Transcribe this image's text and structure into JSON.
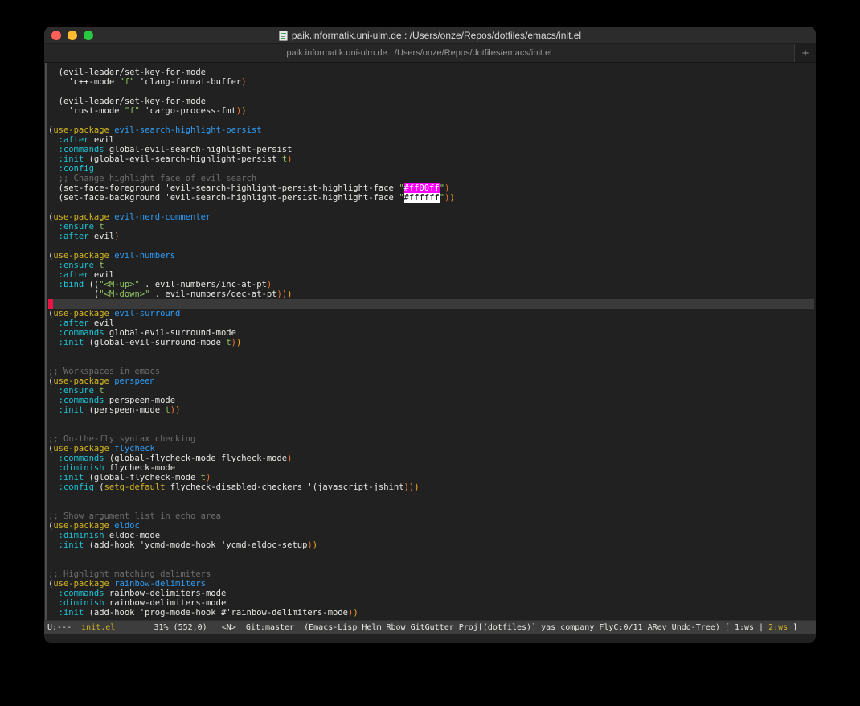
{
  "window": {
    "title": "paik.informatik.uni-ulm.de :  /Users/onze/Repos/dotfiles/emacs/init.el",
    "tab_title": "paik.informatik.uni-ulm.de :  /Users/onze/Repos/dotfiles/emacs/init.el",
    "new_tab_label": "+",
    "file_icon": "document-icon"
  },
  "colors": {
    "accent_yellow": "#d4b520",
    "package_blue": "#2e9cf5",
    "keyword_cyan": "#1fc3d4",
    "string_green": "#93c763",
    "comment_gray": "#6d6d6d",
    "paren_orange": "#ef7733",
    "paren_amber": "#fcae1e",
    "cursor_red": "#ee1346",
    "hexswatch_magenta": "#ff00ff",
    "hexswatch_white": "#ffffff",
    "editor_bg": "#212121",
    "hl_line_bg": "#3a3a3a",
    "modeline_bg": "#3d3d3d",
    "traffic_red": "#ff5f57",
    "traffic_yellow": "#febc2e",
    "traffic_green": "#28c840"
  },
  "editor": {
    "cursor_line_index": 24,
    "lines": [
      [
        [
          "d",
          "  (evil-leader/set-key-for-mode"
        ]
      ],
      [
        [
          "d",
          "    'c++-mode "
        ],
        [
          "g",
          "\"f\""
        ],
        [
          "d",
          " 'clang-format-buffer"
        ],
        [
          "o",
          ")"
        ]
      ],
      [],
      [
        [
          "d",
          "  (evil-leader/set-key-for-mode"
        ]
      ],
      [
        [
          "d",
          "    'rust-mode "
        ],
        [
          "g",
          "\"f\""
        ],
        [
          "d",
          " 'cargo-process-fmt"
        ],
        [
          "o",
          ")"
        ],
        [
          "a",
          ")"
        ]
      ],
      [],
      [
        [
          "d",
          "("
        ],
        [
          "y",
          "use-package"
        ],
        [
          "d",
          " "
        ],
        [
          "b",
          "evil-search-highlight-persist"
        ]
      ],
      [
        [
          "c",
          "  :after"
        ],
        [
          "d",
          " evil"
        ]
      ],
      [
        [
          "c",
          "  :commands"
        ],
        [
          "d",
          " global-evil-search-highlight-persist"
        ]
      ],
      [
        [
          "c",
          "  :init"
        ],
        [
          "d",
          " (global-evil-search-highlight-persist "
        ],
        [
          "g",
          "t"
        ],
        [
          "o",
          ")"
        ]
      ],
      [
        [
          "c",
          "  :config"
        ]
      ],
      [
        [
          "m",
          "  ;; Change highlight face of evil search"
        ]
      ],
      [
        [
          "d",
          "  (set-face-foreground 'evil-search-highlight-persist-highlight-face "
        ],
        [
          "g",
          "\""
        ],
        [
          "hm",
          "#ff00ff"
        ],
        [
          "g",
          "\""
        ],
        [
          "o",
          ")"
        ]
      ],
      [
        [
          "d",
          "  (set-face-background 'evil-search-highlight-persist-highlight-face "
        ],
        [
          "g",
          "\""
        ],
        [
          "hw",
          "#ffffff"
        ],
        [
          "g",
          "\""
        ],
        [
          "o",
          ")"
        ],
        [
          "a",
          ")"
        ]
      ],
      [],
      [
        [
          "d",
          "("
        ],
        [
          "y",
          "use-package"
        ],
        [
          "d",
          " "
        ],
        [
          "b",
          "evil-nerd-commenter"
        ]
      ],
      [
        [
          "c",
          "  :ensure"
        ],
        [
          "d",
          " "
        ],
        [
          "g",
          "t"
        ]
      ],
      [
        [
          "c",
          "  :after"
        ],
        [
          "d",
          " evil"
        ],
        [
          "o",
          ")"
        ]
      ],
      [],
      [
        [
          "d",
          "("
        ],
        [
          "y",
          "use-package"
        ],
        [
          "d",
          " "
        ],
        [
          "b",
          "evil-numbers"
        ]
      ],
      [
        [
          "c",
          "  :ensure"
        ],
        [
          "d",
          " "
        ],
        [
          "g",
          "t"
        ]
      ],
      [
        [
          "c",
          "  :after"
        ],
        [
          "d",
          " evil"
        ]
      ],
      [
        [
          "c",
          "  :bind"
        ],
        [
          "d",
          " (("
        ],
        [
          "g",
          "\"<M-up>\""
        ],
        [
          "d",
          " . evil-numbers/inc-at-pt"
        ],
        [
          "o",
          ")"
        ]
      ],
      [
        [
          "d",
          "         ("
        ],
        [
          "g",
          "\"<M-down>\""
        ],
        [
          "d",
          " . evil-numbers/dec-at-pt"
        ],
        [
          "o",
          ")"
        ],
        [
          "o",
          ")"
        ],
        [
          "a",
          ")"
        ]
      ],
      [],
      [
        [
          "d",
          "("
        ],
        [
          "y",
          "use-package"
        ],
        [
          "d",
          " "
        ],
        [
          "b",
          "evil-surround"
        ]
      ],
      [
        [
          "c",
          "  :after"
        ],
        [
          "d",
          " evil"
        ]
      ],
      [
        [
          "c",
          "  :commands"
        ],
        [
          "d",
          " global-evil-surround-mode"
        ]
      ],
      [
        [
          "c",
          "  :init"
        ],
        [
          "d",
          " (global-evil-surround-mode "
        ],
        [
          "g",
          "t"
        ],
        [
          "o",
          ")"
        ],
        [
          "a",
          ")"
        ]
      ],
      [],
      [],
      [
        [
          "m",
          ";; Workspaces in emacs"
        ]
      ],
      [
        [
          "d",
          "("
        ],
        [
          "y",
          "use-package"
        ],
        [
          "d",
          " "
        ],
        [
          "b",
          "perspeen"
        ]
      ],
      [
        [
          "c",
          "  :ensure"
        ],
        [
          "d",
          " "
        ],
        [
          "g",
          "t"
        ]
      ],
      [
        [
          "c",
          "  :commands"
        ],
        [
          "d",
          " perspeen-mode"
        ]
      ],
      [
        [
          "c",
          "  :init"
        ],
        [
          "d",
          " (perspeen-mode "
        ],
        [
          "g",
          "t"
        ],
        [
          "o",
          ")"
        ],
        [
          "a",
          ")"
        ]
      ],
      [],
      [],
      [
        [
          "m",
          ";; On-the-fly syntax checking"
        ]
      ],
      [
        [
          "d",
          "("
        ],
        [
          "y",
          "use-package"
        ],
        [
          "d",
          " "
        ],
        [
          "b",
          "flycheck"
        ]
      ],
      [
        [
          "c",
          "  :commands"
        ],
        [
          "d",
          " (global-flycheck-mode flycheck-mode"
        ],
        [
          "o",
          ")"
        ]
      ],
      [
        [
          "c",
          "  :diminish"
        ],
        [
          "d",
          " flycheck-mode"
        ]
      ],
      [
        [
          "c",
          "  :init"
        ],
        [
          "d",
          " (global-flycheck-mode "
        ],
        [
          "g",
          "t"
        ],
        [
          "o",
          ")"
        ]
      ],
      [
        [
          "c",
          "  :config"
        ],
        [
          "d",
          " ("
        ],
        [
          "y",
          "setq-default"
        ],
        [
          "d",
          " flycheck-disabled-checkers '(javascript-jshint"
        ],
        [
          "o",
          ")"
        ],
        [
          "o",
          ")"
        ],
        [
          "a",
          ")"
        ]
      ],
      [],
      [],
      [
        [
          "m",
          ";; Show argument list in echo area"
        ]
      ],
      [
        [
          "d",
          "("
        ],
        [
          "y",
          "use-package"
        ],
        [
          "d",
          " "
        ],
        [
          "b",
          "eldoc"
        ]
      ],
      [
        [
          "c",
          "  :diminish"
        ],
        [
          "d",
          " eldoc-mode"
        ]
      ],
      [
        [
          "c",
          "  :init"
        ],
        [
          "d",
          " (add-hook 'ycmd-mode-hook 'ycmd-eldoc-setup"
        ],
        [
          "o",
          ")"
        ],
        [
          "a",
          ")"
        ]
      ],
      [],
      [],
      [
        [
          "m",
          ";; Highlight matching delimiters"
        ]
      ],
      [
        [
          "d",
          "("
        ],
        [
          "y",
          "use-package"
        ],
        [
          "d",
          " "
        ],
        [
          "b",
          "rainbow-delimiters"
        ]
      ],
      [
        [
          "c",
          "  :commands"
        ],
        [
          "d",
          " rainbow-delimiters-mode"
        ]
      ],
      [
        [
          "c",
          "  :diminish"
        ],
        [
          "d",
          " rainbow-delimiters-mode"
        ]
      ],
      [
        [
          "c",
          "  :init"
        ],
        [
          "d",
          " (add-hook 'prog-mode-hook #'rainbow-delimiters-mode"
        ],
        [
          "o",
          ")"
        ],
        [
          "a",
          ")"
        ]
      ]
    ]
  },
  "modeline": {
    "segments": [
      [
        "d",
        "U:---  "
      ],
      [
        "y",
        "init.el"
      ],
      [
        "d",
        "        31% (552,0)   <N>  Git:master  (Emacs-Lisp Helm Rbow GitGutter Proj[(dotfiles)] yas company FlyC:0/11 ARev Undo-Tree) [ 1:ws | "
      ],
      [
        "y",
        "2:ws"
      ],
      [
        "d",
        " ]"
      ]
    ]
  }
}
